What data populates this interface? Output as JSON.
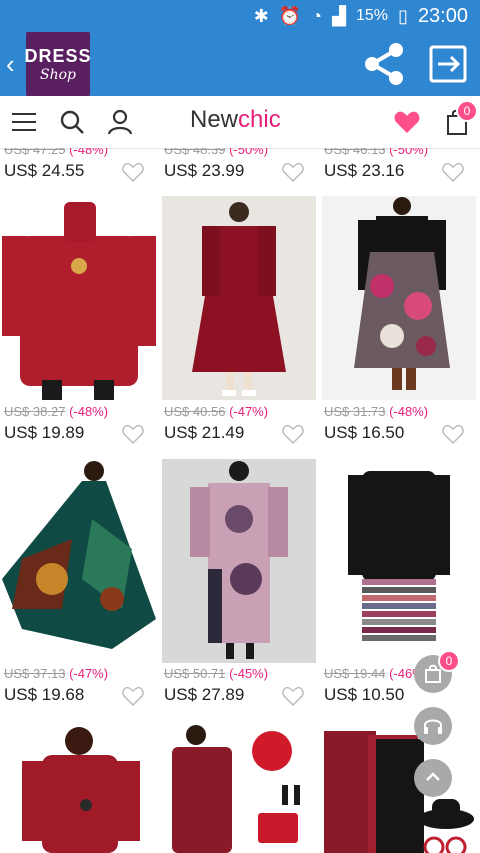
{
  "status_bar": {
    "battery_pct": "15%",
    "time": "23:00"
  },
  "app_bar": {
    "logo_line1": "DRESS",
    "logo_line2": "Shop"
  },
  "site": {
    "brand_part1": "New",
    "brand_part2": "chic",
    "cart_count": "0"
  },
  "products": [
    {
      "old": "US$ 47.25",
      "disc": "(-48%)",
      "price": "US$ 24.55"
    },
    {
      "old": "US$ 48.39",
      "disc": "(-50%)",
      "price": "US$ 23.99"
    },
    {
      "old": "US$ 46.13",
      "disc": "(-50%)",
      "price": "US$ 23.16"
    },
    {
      "old": "US$ 38.27",
      "disc": "(-48%)",
      "price": "US$ 19.89"
    },
    {
      "old": "US$ 40.56",
      "disc": "(-47%)",
      "price": "US$ 21.49"
    },
    {
      "old": "US$ 31.73",
      "disc": "(-48%)",
      "price": "US$ 16.50"
    },
    {
      "old": "US$ 37.13",
      "disc": "(-47%)",
      "price": "US$ 19.68"
    },
    {
      "old": "US$ 50.71",
      "disc": "(-45%)",
      "price": "US$ 27.89"
    },
    {
      "old": "US$ 19.44",
      "disc": "(-46%)",
      "price": "US$ 10.50"
    }
  ],
  "floating": {
    "cart_count": "0"
  },
  "colors": {
    "primary": "#2f86d1",
    "accent": "#e91e7a"
  }
}
